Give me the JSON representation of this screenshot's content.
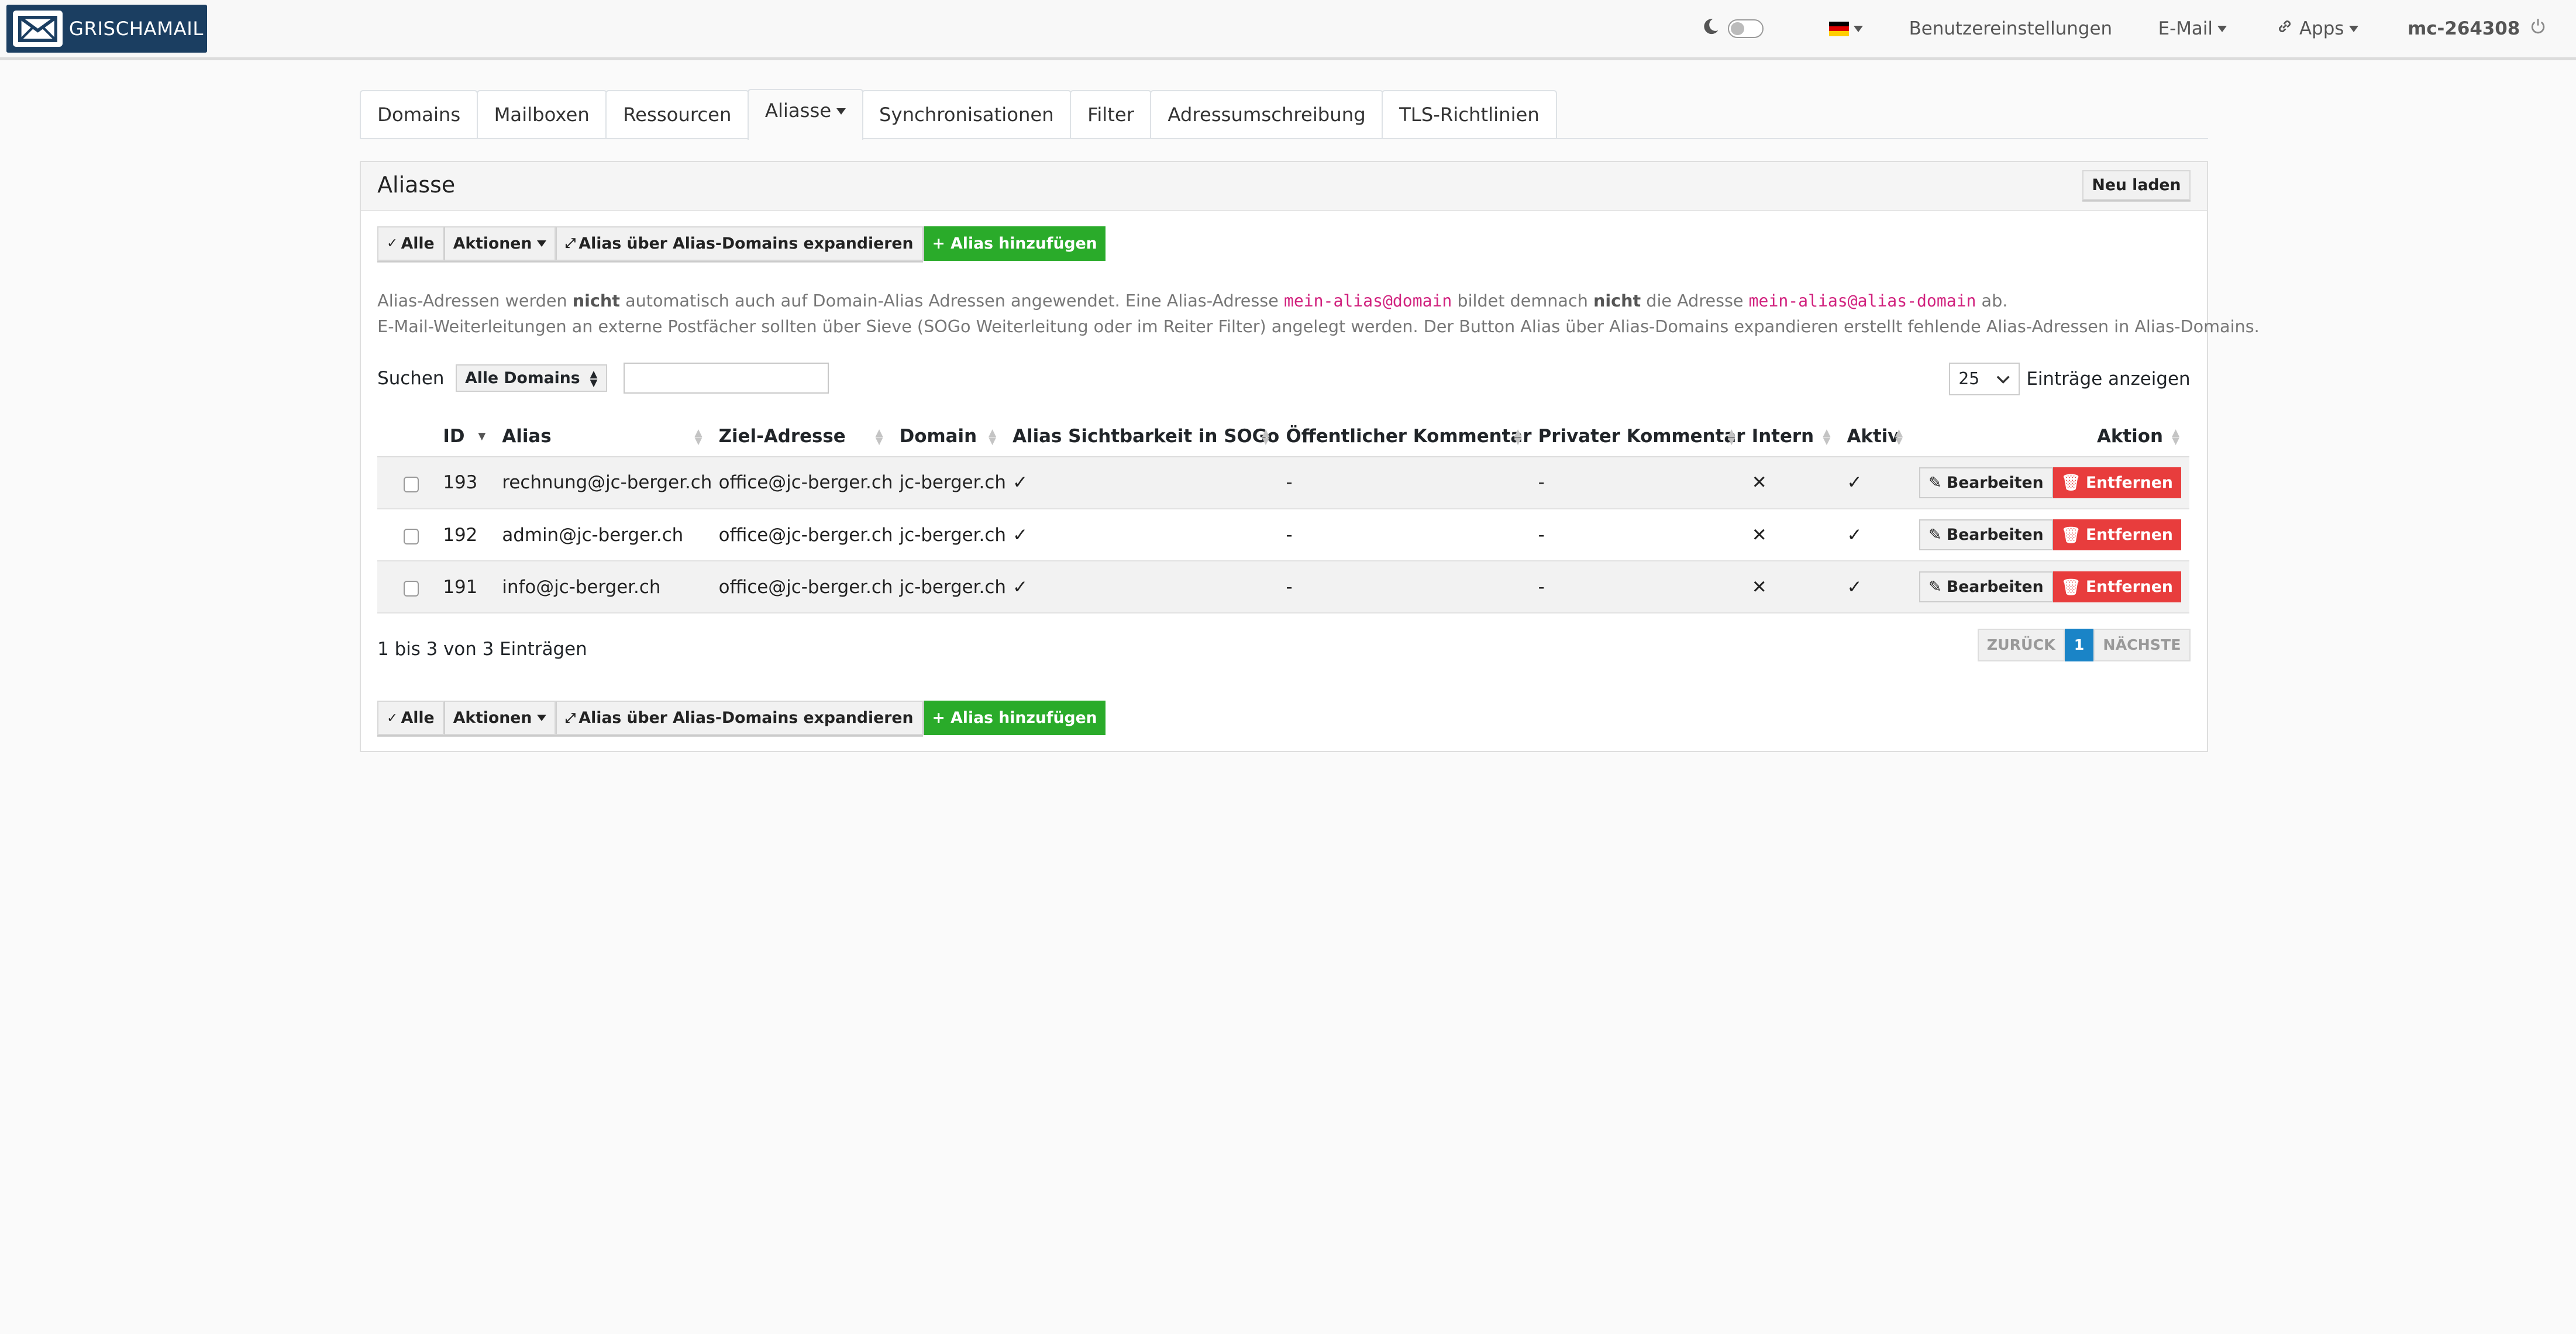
{
  "brand": {
    "name": "GRISCHAMAIL"
  },
  "navbar": {
    "language": "DE",
    "user_settings": "Benutzereinstellungen",
    "email_menu": "E-Mail",
    "apps_menu": "Apps",
    "username": "mc-264308"
  },
  "tabs": [
    "Domains",
    "Mailboxen",
    "Ressourcen",
    "Aliasse",
    "Synchronisationen",
    "Filter",
    "Adressumschreibung",
    "TLS-Richtlinien"
  ],
  "active_tab": "Aliasse",
  "panel": {
    "title": "Aliasse",
    "reload": "Neu laden"
  },
  "toolbar": {
    "select_all": "Alle",
    "actions": "Aktionen",
    "expand": "Alias über Alias-Domains expandieren",
    "add": "+ Alias hinzufügen"
  },
  "info": {
    "line1_a": "Alias-Adressen werden ",
    "line1_b": "nicht",
    "line1_c": " automatisch auch auf Domain-Alias Adressen angewendet. Eine Alias-Adresse ",
    "code1": "mein-alias@domain",
    "line1_d": " bildet demnach ",
    "line1_e": "nicht",
    "line1_f": " die Adresse ",
    "code2": "mein-alias@alias-domain",
    "line1_g": " ab.",
    "line2": "E-Mail-Weiterleitungen an externe Postfächer sollten über Sieve (SOGo Weiterleitung oder im Reiter Filter) angelegt werden. Der Button Alias über Alias-Domains expandieren erstellt fehlende Alias-Adressen in Alias-Domains."
  },
  "search": {
    "label": "Suchen",
    "domain_filter": "Alle Domains",
    "value": ""
  },
  "length": {
    "value": "25",
    "label": "Einträge anzeigen"
  },
  "table": {
    "columns": [
      "ID",
      "Alias",
      "Ziel-Adresse",
      "Domain",
      "Alias Sichtbarkeit in SOGo",
      "Öffentlicher Kommentar",
      "Privater Kommentar",
      "Intern",
      "Aktiv",
      "Aktion"
    ],
    "rows": [
      {
        "id": "193",
        "alias": "rechnung@jc-berger.ch",
        "target": "office@jc-berger.ch",
        "domain": "jc-berger.ch",
        "sogo_visible": "✓",
        "public_comment": "-",
        "private_comment": "-",
        "internal": "✕",
        "active": "✓"
      },
      {
        "id": "192",
        "alias": "admin@jc-berger.ch",
        "target": "office@jc-berger.ch",
        "domain": "jc-berger.ch",
        "sogo_visible": "✓",
        "public_comment": "-",
        "private_comment": "-",
        "internal": "✕",
        "active": "✓"
      },
      {
        "id": "191",
        "alias": "info@jc-berger.ch",
        "target": "office@jc-berger.ch",
        "domain": "jc-berger.ch",
        "sogo_visible": "✓",
        "public_comment": "-",
        "private_comment": "-",
        "internal": "✕",
        "active": "✓"
      }
    ],
    "edit_label": "Bearbeiten",
    "remove_label": "Entfernen"
  },
  "footer": {
    "info": "1 bis 3 von 3 Einträgen",
    "prev": "ZURÜCK",
    "page": "1",
    "next": "NÄCHSTE"
  },
  "colors": {
    "brand": "#1b3e61",
    "add_button": "#2aab2a",
    "remove_button": "#e83d3d",
    "current_page": "#1a84c7",
    "code": "#d1227e"
  }
}
